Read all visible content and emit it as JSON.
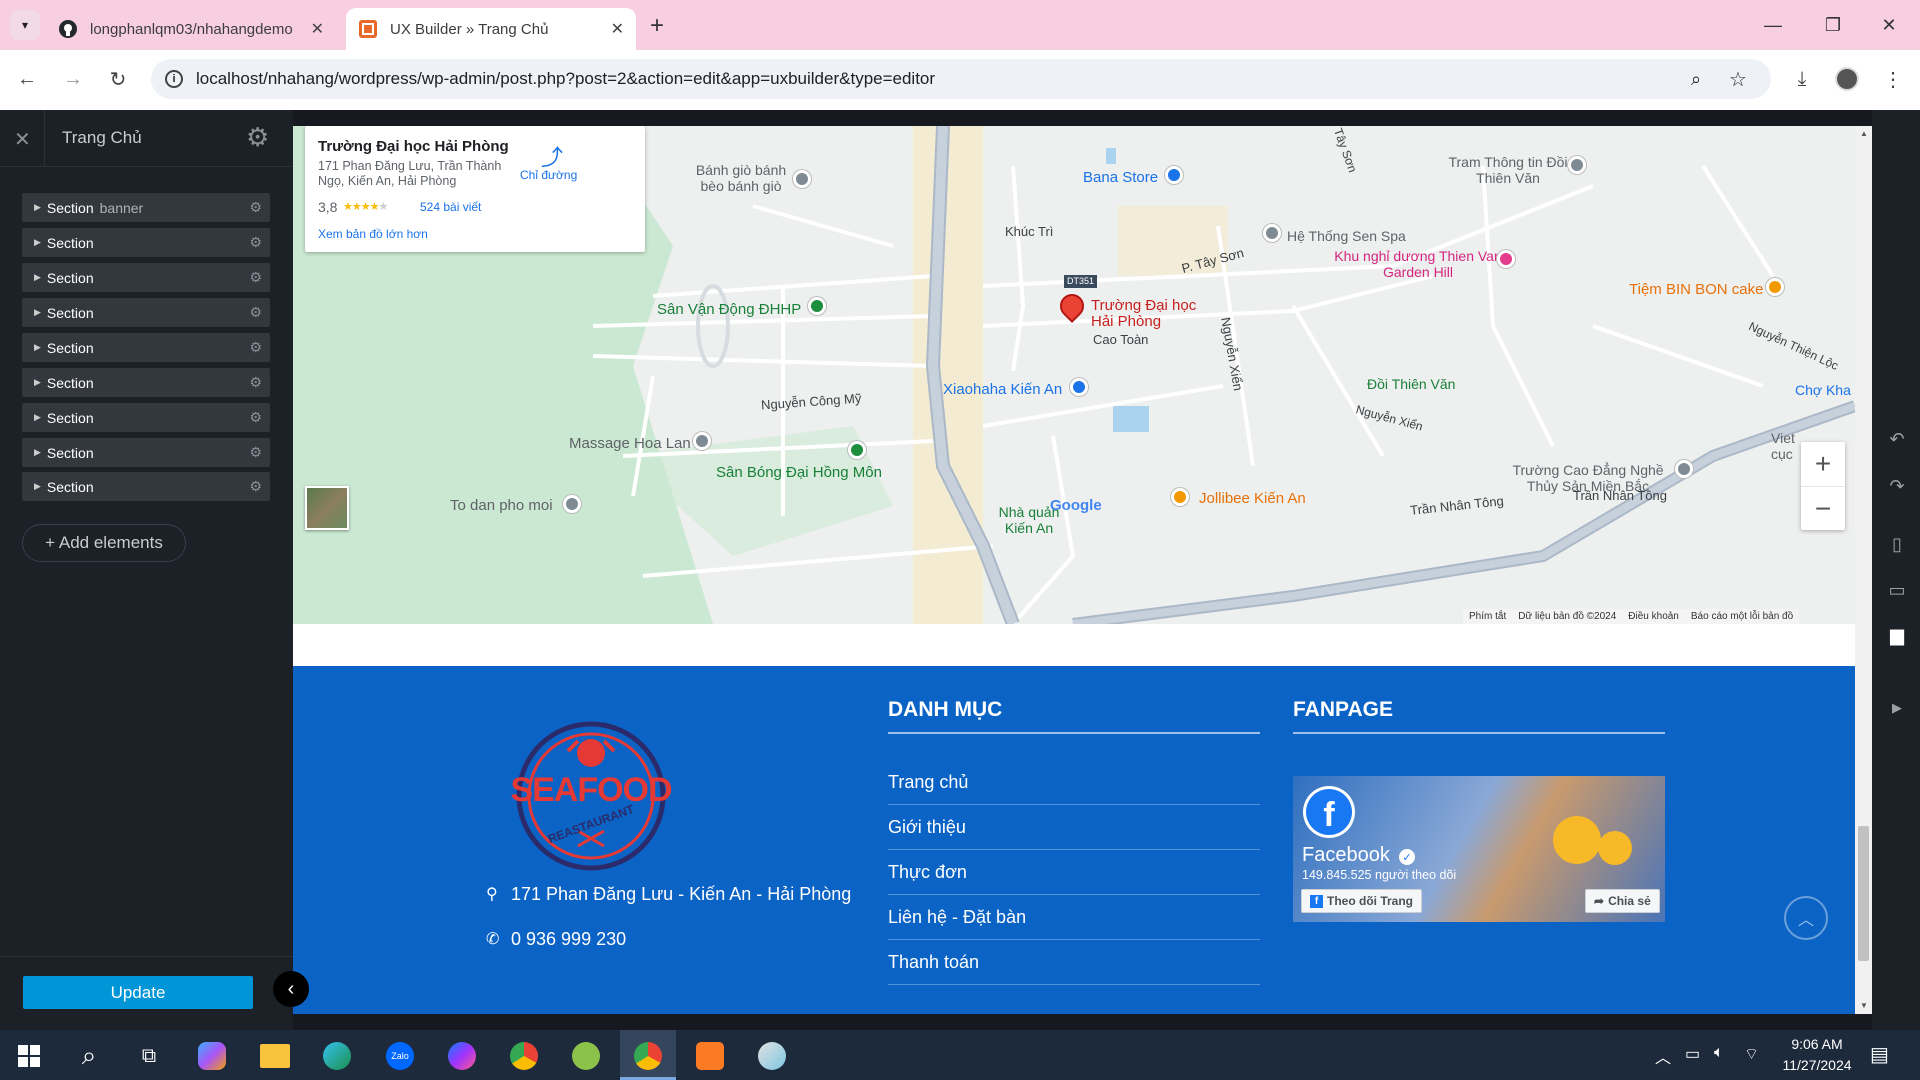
{
  "browser": {
    "tabs": [
      {
        "title": "longphanlqm03/nhahangdemo",
        "active": false
      },
      {
        "title": "UX Builder » Trang Chủ",
        "active": true
      }
    ],
    "url": "localhost/nhahang/wordpress/wp-admin/post.php?post=2&action=edit&app=uxbuilder&type=editor"
  },
  "sidebar": {
    "title": "Trang Chủ",
    "items": [
      {
        "label": "Section",
        "sub": "banner"
      },
      {
        "label": "Section",
        "sub": ""
      },
      {
        "label": "Section",
        "sub": ""
      },
      {
        "label": "Section",
        "sub": ""
      },
      {
        "label": "Section",
        "sub": ""
      },
      {
        "label": "Section",
        "sub": ""
      },
      {
        "label": "Section",
        "sub": ""
      },
      {
        "label": "Section",
        "sub": ""
      },
      {
        "label": "Section",
        "sub": ""
      }
    ],
    "add_elements": "+ Add elements",
    "update_button": "Update"
  },
  "map": {
    "card": {
      "name": "Trường Đại học Hải Phòng",
      "address": "171 Phan Đăng Lưu, Trần Thành Ngọ, Kiến An, Hải Phòng",
      "rating": "3,8",
      "stars": 3.8,
      "reviews": "524 bài viết",
      "directions": "Chỉ đường",
      "larger_map": "Xem bản đồ lớn hơn"
    },
    "labels": [
      "Bánh giò bánh bèo bánh giò",
      "Bana Store",
      "Tram Thông tin Đồi Thiên Văn",
      "Khúc Trì",
      "Hệ Thống Sen Spa",
      "P. Tây Sơn",
      "Khu nghỉ dương Thien Van Garden Hill",
      "DT351",
      "Tiệm BIN BON cake",
      "Sân Vận Động ĐHHP",
      "Trường Đại học Hải Phòng",
      "Cao Toàn",
      "Nguyễn Xiển",
      "Xiaohaha Kiến An",
      "Đồi Thiên Văn",
      "Nguyễn Công Mỹ",
      "Massage Hoa Lan",
      "Sân Bóng Đại Hồng Môn",
      "Nguyễn Xiển",
      "Trường Cao Đẳng Nghề Thủy Sản Miền Bắc",
      "Chợ Kha",
      "Viet cục",
      "Jollibee Kiến An",
      "Trần Nhân Tông",
      "Trần Nhân Tông",
      "To dan pho moi",
      "Nhà quản Kiến An",
      "Nguyễn Thiện Lộc",
      "Tây Sơn",
      "Google"
    ],
    "attribution": [
      "Phím tắt",
      "Dữ liệu bản đồ ©2024",
      "Điều khoản",
      "Báo cáo một lỗi bản đồ"
    ]
  },
  "footer": {
    "logo_text": "SEAFOOD",
    "logo_sub": "REASTAURANT",
    "address": "171 Phan Đăng Lưu - Kiến An - Hải Phòng",
    "phone": "0 936 999 230",
    "menu_title": "DANH MỤC",
    "menu": [
      "Trang chủ",
      "Giới thiệu",
      "Thực đơn",
      "Liên hệ - Đặt bàn",
      "Thanh toán"
    ],
    "fanpage_title": "FANPAGE",
    "fb": {
      "name": "Facebook",
      "followers": "149.845.525 người theo dõi",
      "follow": "Theo dõi Trang",
      "share": "Chia sẻ"
    }
  },
  "taskbar": {
    "time": "9:06 AM",
    "date": "11/27/2024"
  },
  "colors": {
    "footer": "#0a63c5",
    "update": "#0095d6",
    "tabbar": "#f8cfe0"
  }
}
